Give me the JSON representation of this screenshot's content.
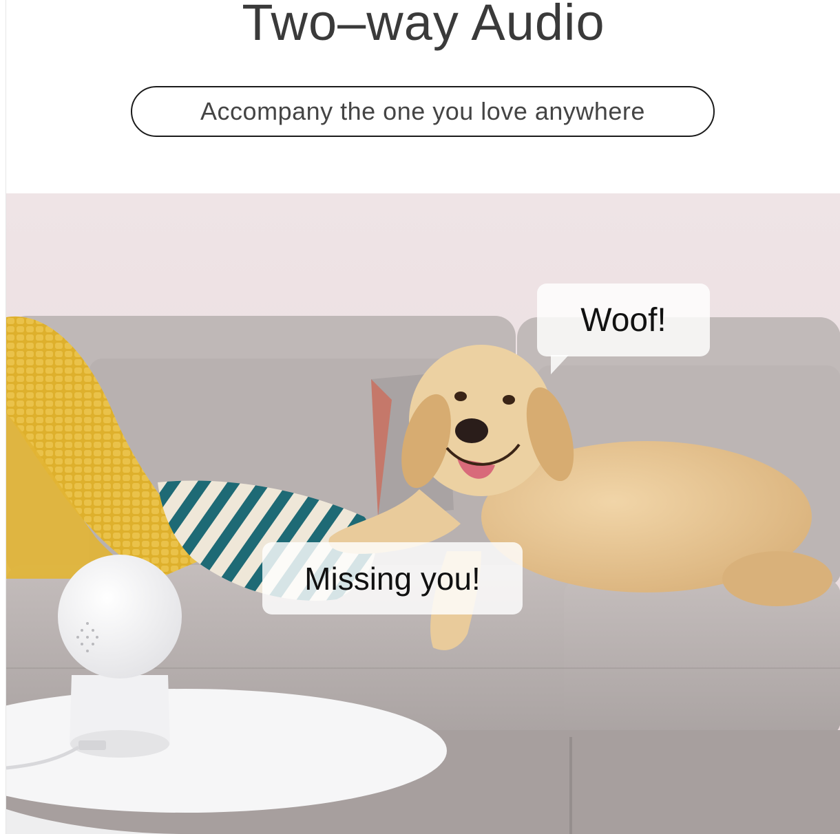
{
  "header": {
    "title": "Two–way Audio",
    "tagline": "Accompany the one you love anywhere"
  },
  "speech": {
    "dog": "Woof!",
    "camera": "Missing you!"
  },
  "colors": {
    "wall": "#ece0e2",
    "sofa": "#b9b2b1",
    "blanket": "#e0b431",
    "dog": "#e5c38e",
    "table": "#f7f7f8",
    "pillow_stripes": "#1f6b76"
  }
}
